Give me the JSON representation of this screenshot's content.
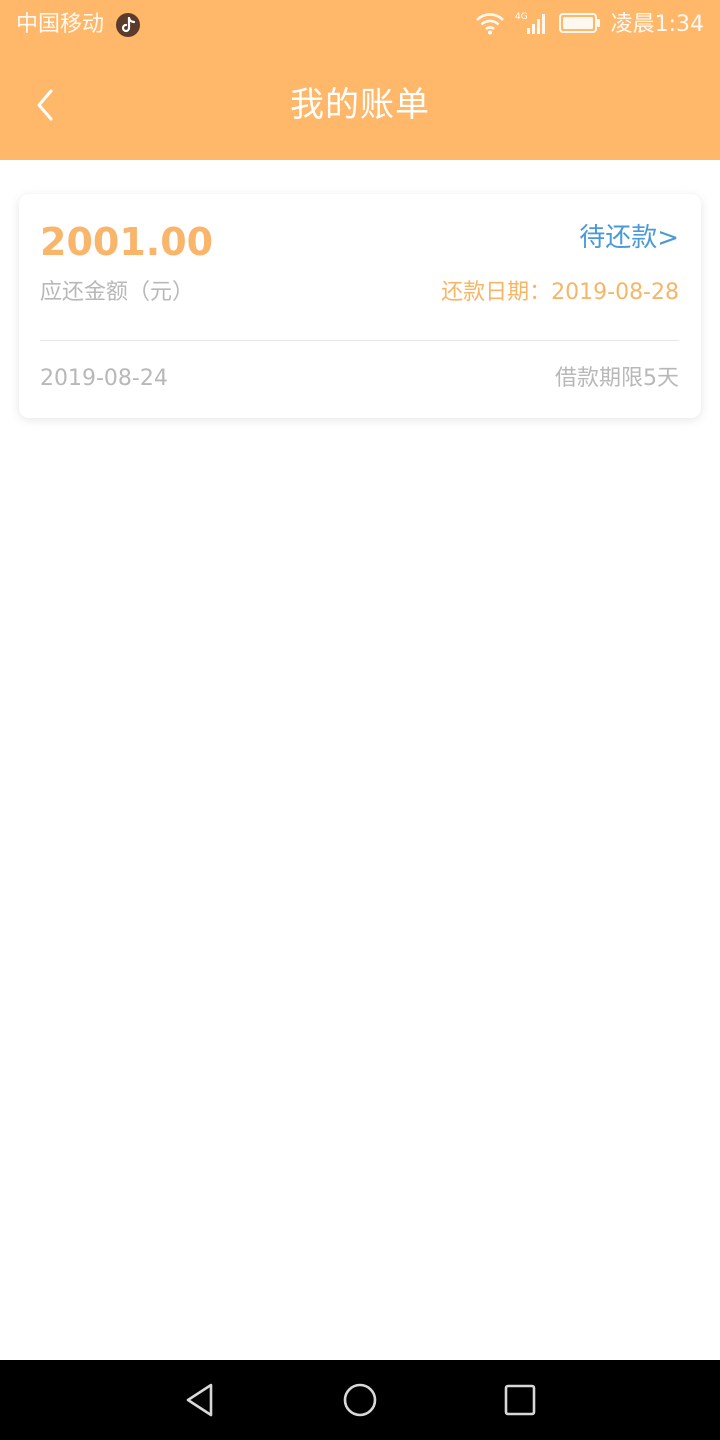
{
  "status_bar": {
    "carrier": "中国移动",
    "network": "4G",
    "time": "凌晨1:34"
  },
  "app_bar": {
    "title": "我的账单"
  },
  "bill": {
    "amount": "2001.00",
    "amount_label": "应还金额（元）",
    "status": "待还款>",
    "due_date": "还款日期：2019-08-28",
    "loan_date": "2019-08-24",
    "loan_term": "借款期限5天"
  },
  "colors": {
    "header_bg": "#ffb76a",
    "amount": "#f9b56a",
    "status_link": "#4a9ad6",
    "secondary_text": "#b8b8b8"
  },
  "icons": {
    "back": "back-arrow-icon",
    "wifi": "wifi-icon",
    "signal": "signal-icon",
    "battery": "battery-icon",
    "nav_back": "nav-back-icon",
    "nav_home": "nav-home-icon",
    "nav_recent": "nav-recent-icon"
  }
}
